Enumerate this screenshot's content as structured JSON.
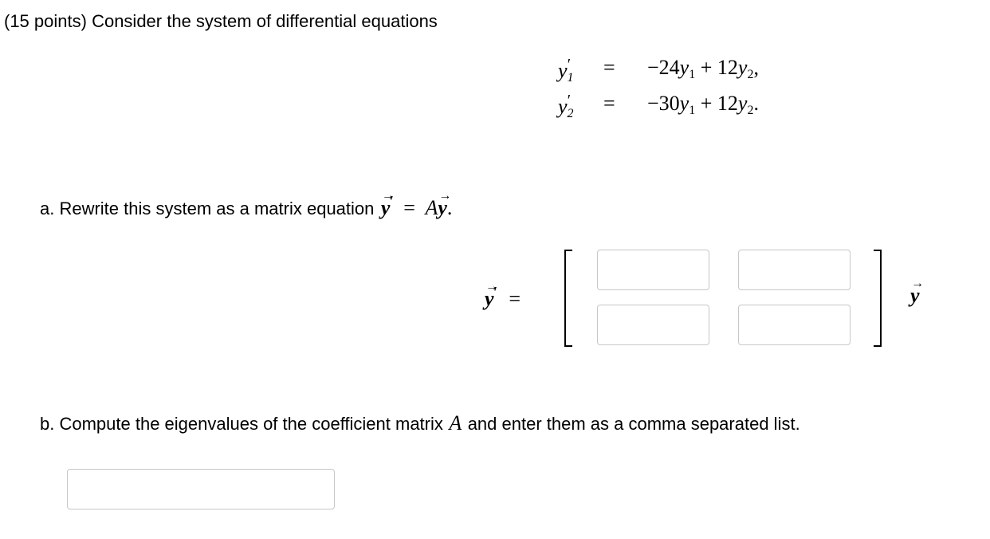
{
  "header": {
    "points": "(15 points)",
    "intro": "Consider the system of differential equations"
  },
  "system": {
    "eq1": {
      "lhs_var": "y",
      "lhs_sub": "1",
      "prime": "′",
      "equals": "=",
      "rhs": "−24y₁ + 12y₂,",
      "rhs_parts": {
        "c1": "−24",
        "v1": "y",
        "s1": "1",
        "op": " + ",
        "c2": "12",
        "v2": "y",
        "s2": "2",
        "end": ","
      }
    },
    "eq2": {
      "lhs_var": "y",
      "lhs_sub": "2",
      "prime": "′",
      "equals": "=",
      "rhs": "−30y₁ + 12y₂.",
      "rhs_parts": {
        "c1": "−30",
        "v1": "y",
        "s1": "1",
        "op": " + ",
        "c2": "12",
        "v2": "y",
        "s2": "2",
        "end": "."
      }
    }
  },
  "part_a": {
    "label": "a. Rewrite this system as a matrix equation",
    "vec_var": "y",
    "arrow": "⃗",
    "prime": "′",
    "equals": "=",
    "matrix_var": "A",
    "end": ".",
    "matrix_inputs": [
      {
        "value": ""
      },
      {
        "value": ""
      },
      {
        "value": ""
      },
      {
        "value": ""
      }
    ]
  },
  "part_b": {
    "label_before": "b. Compute the eigenvalues of the coefficient matrix",
    "matrix_var": "A",
    "label_after": "and enter them as a comma separated list.",
    "answer_value": ""
  }
}
